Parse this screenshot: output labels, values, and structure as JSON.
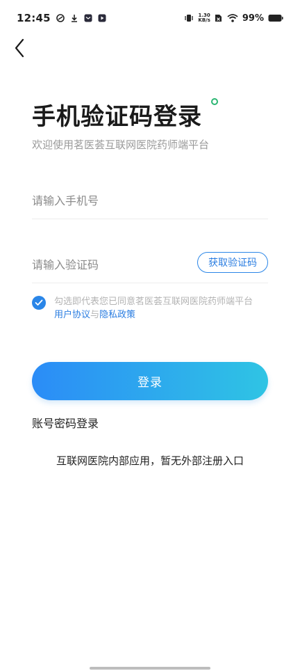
{
  "status_bar": {
    "time": "12:45",
    "net_speed_value": "1.30",
    "net_speed_unit": "KB/s",
    "battery_percent": "99%",
    "left_icons": [
      "cloud-sync-icon",
      "download-icon",
      "mail-app-icon",
      "play-app-icon"
    ],
    "right_icons": [
      "vibrate-icon",
      "no-sim-icon",
      "wifi-icon",
      "battery-icon"
    ]
  },
  "header": {
    "back_icon": "chevron-left-icon"
  },
  "page": {
    "title": "手机验证码登录",
    "subtitle": "欢迎使用茗医荟互联网医院药师端平台"
  },
  "form": {
    "phone_placeholder": "请输入手机号",
    "code_placeholder": "请输入验证码",
    "get_code_label": "获取验证码"
  },
  "agreement": {
    "checked": true,
    "prefix": "勾选即代表您已同意茗医荟互联网医院药师端平台",
    "user_agreement": "用户协议",
    "joiner": "与",
    "privacy_policy": "隐私政策"
  },
  "actions": {
    "login_label": "登录",
    "password_login_label": "账号密码登录"
  },
  "notice": "互联网医院内部应用，暂无外部注册入口",
  "colors": {
    "accent": "#2a86e8",
    "gradient_start": "#2b8cf7",
    "gradient_end": "#2fc4e4",
    "title_dot": "#2bb673"
  }
}
